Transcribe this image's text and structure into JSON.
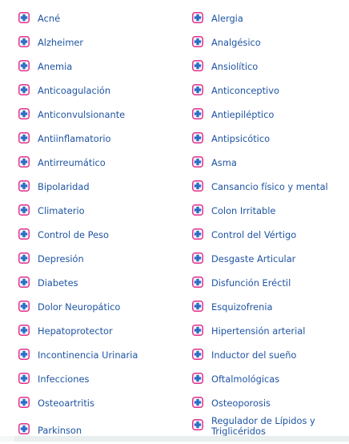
{
  "colors": {
    "link": "#1f55a3",
    "icon_border": "#e0318a",
    "icon_cross": "#2b6fc9"
  },
  "icon_name": "medical-cross-icon",
  "columns": {
    "left": [
      "Acné",
      "Alzheimer",
      "Anemia",
      "Anticoagulación",
      "Anticonvulsionante",
      "Antiinflamatorio",
      "Antirreumático",
      "Bipolaridad",
      "Climaterio",
      "Control de Peso",
      "Depresión",
      "Diabetes",
      "Dolor Neuropático",
      "Hepatoprotector",
      "Incontinencia Urinaria",
      "Infecciones",
      "Osteoartritis",
      "Parkinson"
    ],
    "right": [
      "Alergia",
      "Analgésico",
      "Ansiolítico",
      "Anticonceptivo",
      "Antiepiléptico",
      "Antipsicótico",
      "Asma",
      "Cansancio físico y mental",
      "Colon Irritable",
      "Control del Vértigo",
      "Desgaste Articular",
      "Disfunción Eréctil",
      "Esquizofrenia",
      "Hipertensión arterial",
      "Inductor del sueño",
      "Oftalmológicas",
      "Osteoporosis",
      "Regulador de Lípidos y Triglicéridos"
    ]
  }
}
